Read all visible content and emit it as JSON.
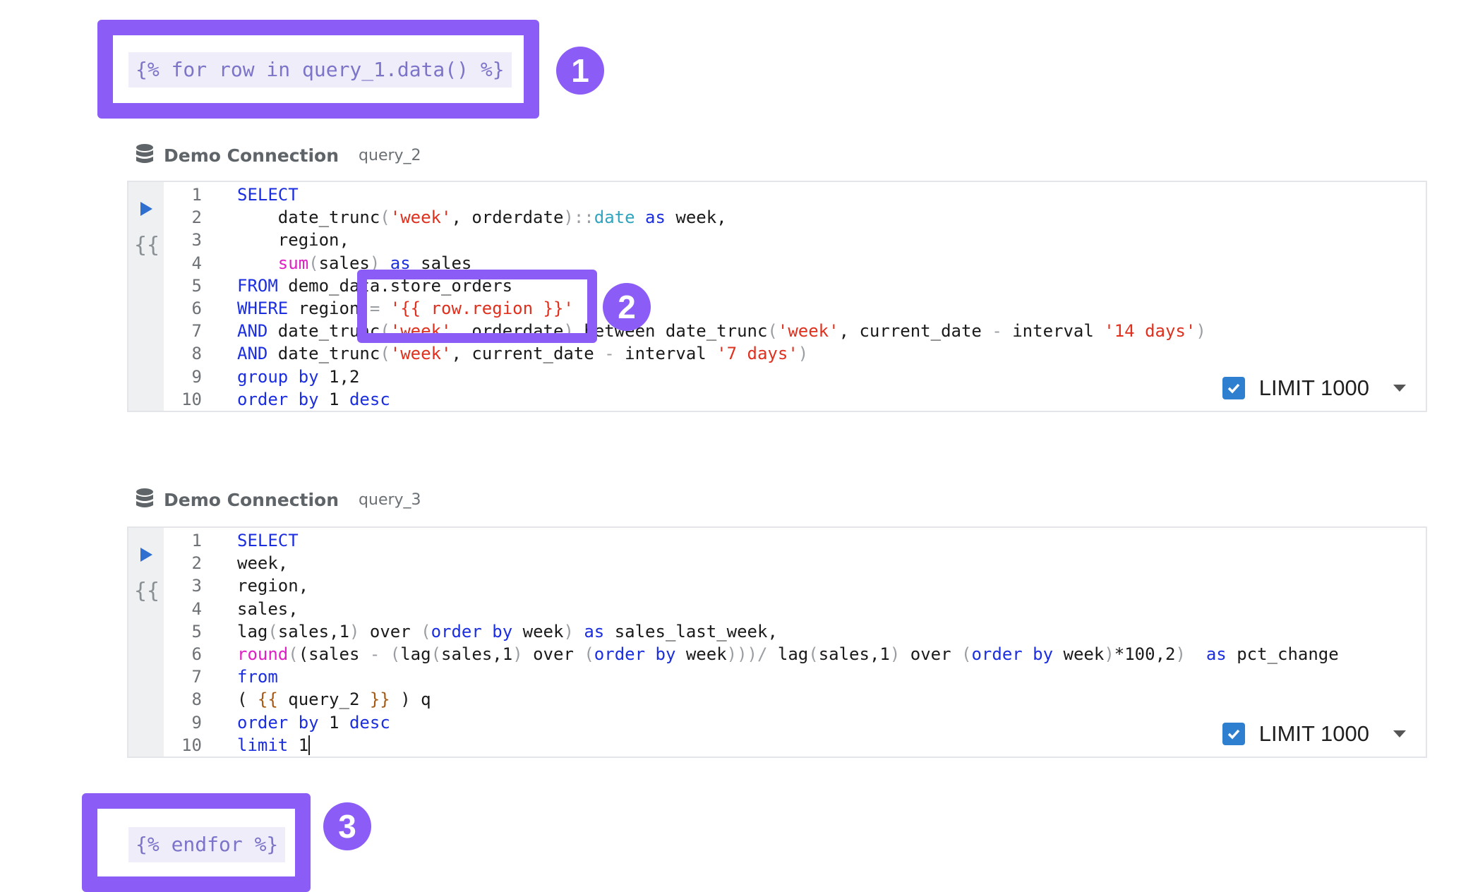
{
  "loop_start": "{% for row in query_1.data() %}",
  "loop_end": "{% endfor %}",
  "callouts": [
    "1",
    "2",
    "3"
  ],
  "cells": [
    {
      "connection": "Demo Connection",
      "query_name": "query_2",
      "limit_label": "LIMIT 1000",
      "limit_checked": true,
      "lines": [
        {
          "n": "1",
          "segs": [
            {
              "t": "SELECT",
              "c": "kw"
            }
          ]
        },
        {
          "n": "2",
          "segs": [
            {
              "t": "    date_trunc",
              "c": ""
            },
            {
              "t": "(",
              "c": "op"
            },
            {
              "t": "'week'",
              "c": "str"
            },
            {
              "t": ", orderdate",
              "c": ""
            },
            {
              "t": ")::",
              "c": "op"
            },
            {
              "t": "date",
              "c": "typ"
            },
            {
              "t": " ",
              "c": ""
            },
            {
              "t": "as",
              "c": "kw"
            },
            {
              "t": " week,",
              "c": ""
            }
          ]
        },
        {
          "n": "3",
          "segs": [
            {
              "t": "    region,",
              "c": ""
            }
          ]
        },
        {
          "n": "4",
          "segs": [
            {
              "t": "    ",
              "c": ""
            },
            {
              "t": "sum",
              "c": "fn"
            },
            {
              "t": "(",
              "c": "op"
            },
            {
              "t": "sales",
              "c": ""
            },
            {
              "t": ")",
              "c": "op"
            },
            {
              "t": " ",
              "c": ""
            },
            {
              "t": "as",
              "c": "kw"
            },
            {
              "t": " sales",
              "c": ""
            }
          ]
        },
        {
          "n": "5",
          "segs": [
            {
              "t": "FROM",
              "c": "kw"
            },
            {
              "t": " demo_data.store_orders",
              "c": ""
            }
          ]
        },
        {
          "n": "6",
          "segs": [
            {
              "t": "WHERE",
              "c": "kw"
            },
            {
              "t": " region ",
              "c": ""
            },
            {
              "t": "=",
              "c": "op"
            },
            {
              "t": " ",
              "c": ""
            },
            {
              "t": "'{{ row.region }}'",
              "c": "str"
            }
          ]
        },
        {
          "n": "7",
          "segs": [
            {
              "t": "AND",
              "c": "kw"
            },
            {
              "t": " date_trunc",
              "c": ""
            },
            {
              "t": "(",
              "c": "op"
            },
            {
              "t": "'week'",
              "c": "str"
            },
            {
              "t": ", orderdate",
              "c": ""
            },
            {
              "t": ")",
              "c": "op"
            },
            {
              "t": " between date_trunc",
              "c": ""
            },
            {
              "t": "(",
              "c": "op"
            },
            {
              "t": "'week'",
              "c": "str"
            },
            {
              "t": ", current_date ",
              "c": ""
            },
            {
              "t": "-",
              "c": "op"
            },
            {
              "t": " interval ",
              "c": ""
            },
            {
              "t": "'14 days'",
              "c": "str"
            },
            {
              "t": ")",
              "c": "op"
            }
          ]
        },
        {
          "n": "8",
          "segs": [
            {
              "t": "AND",
              "c": "kw"
            },
            {
              "t": " date_trunc",
              "c": ""
            },
            {
              "t": "(",
              "c": "op"
            },
            {
              "t": "'week'",
              "c": "str"
            },
            {
              "t": ", current_date ",
              "c": ""
            },
            {
              "t": "-",
              "c": "op"
            },
            {
              "t": " interval ",
              "c": ""
            },
            {
              "t": "'7 days'",
              "c": "str"
            },
            {
              "t": ")",
              "c": "op"
            }
          ]
        },
        {
          "n": "9",
          "segs": [
            {
              "t": "group",
              "c": "kw"
            },
            {
              "t": " ",
              "c": ""
            },
            {
              "t": "by",
              "c": "kw"
            },
            {
              "t": " 1,2",
              "c": ""
            }
          ]
        },
        {
          "n": "10",
          "segs": [
            {
              "t": "order",
              "c": "kw"
            },
            {
              "t": " ",
              "c": ""
            },
            {
              "t": "by",
              "c": "kw"
            },
            {
              "t": " 1 ",
              "c": ""
            },
            {
              "t": "desc",
              "c": "kw"
            }
          ]
        }
      ]
    },
    {
      "connection": "Demo Connection",
      "query_name": "query_3",
      "limit_label": "LIMIT 1000",
      "limit_checked": true,
      "lines": [
        {
          "n": "1",
          "segs": [
            {
              "t": "SELECT",
              "c": "kw"
            }
          ]
        },
        {
          "n": "2",
          "segs": [
            {
              "t": "week,",
              "c": ""
            }
          ]
        },
        {
          "n": "3",
          "segs": [
            {
              "t": "region,",
              "c": ""
            }
          ]
        },
        {
          "n": "4",
          "segs": [
            {
              "t": "sales,",
              "c": ""
            }
          ]
        },
        {
          "n": "5",
          "segs": [
            {
              "t": "lag",
              "c": ""
            },
            {
              "t": "(",
              "c": "op"
            },
            {
              "t": "sales,1",
              "c": ""
            },
            {
              "t": ")",
              "c": "op"
            },
            {
              "t": " over ",
              "c": ""
            },
            {
              "t": "(",
              "c": "op"
            },
            {
              "t": "order",
              "c": "kw"
            },
            {
              "t": " ",
              "c": ""
            },
            {
              "t": "by",
              "c": "kw"
            },
            {
              "t": " week",
              "c": ""
            },
            {
              "t": ")",
              "c": "op"
            },
            {
              "t": " ",
              "c": ""
            },
            {
              "t": "as",
              "c": "kw"
            },
            {
              "t": " sales_last_week,",
              "c": ""
            }
          ]
        },
        {
          "n": "6",
          "segs": [
            {
              "t": "round",
              "c": "fn"
            },
            {
              "t": "(",
              "c": "op"
            },
            {
              "t": "(sales ",
              "c": ""
            },
            {
              "t": "-",
              "c": "op"
            },
            {
              "t": " ",
              "c": ""
            },
            {
              "t": "(",
              "c": "op"
            },
            {
              "t": "lag",
              "c": ""
            },
            {
              "t": "(",
              "c": "op"
            },
            {
              "t": "sales,1",
              "c": ""
            },
            {
              "t": ")",
              "c": "op"
            },
            {
              "t": " over ",
              "c": ""
            },
            {
              "t": "(",
              "c": "op"
            },
            {
              "t": "order",
              "c": "kw"
            },
            {
              "t": " ",
              "c": ""
            },
            {
              "t": "by",
              "c": "kw"
            },
            {
              "t": " week",
              "c": ""
            },
            {
              "t": ")))/",
              "c": "op"
            },
            {
              "t": " lag",
              "c": ""
            },
            {
              "t": "(",
              "c": "op"
            },
            {
              "t": "sales,1",
              "c": ""
            },
            {
              "t": ")",
              "c": "op"
            },
            {
              "t": " over ",
              "c": ""
            },
            {
              "t": "(",
              "c": "op"
            },
            {
              "t": "order",
              "c": "kw"
            },
            {
              "t": " ",
              "c": ""
            },
            {
              "t": "by",
              "c": "kw"
            },
            {
              "t": " week",
              "c": ""
            },
            {
              "t": ")",
              "c": "op"
            },
            {
              "t": "*100,2",
              "c": ""
            },
            {
              "t": ")",
              "c": "op"
            },
            {
              "t": "  ",
              "c": ""
            },
            {
              "t": "as",
              "c": "kw"
            },
            {
              "t": " pct_change",
              "c": ""
            }
          ]
        },
        {
          "n": "7",
          "segs": [
            {
              "t": "from",
              "c": "kw"
            }
          ]
        },
        {
          "n": "8",
          "segs": [
            {
              "t": "( ",
              "c": ""
            },
            {
              "t": "{{",
              "c": "jn"
            },
            {
              "t": " query_2 ",
              "c": ""
            },
            {
              "t": "}}",
              "c": "jn"
            },
            {
              "t": " ) q",
              "c": ""
            }
          ]
        },
        {
          "n": "9",
          "segs": [
            {
              "t": "order",
              "c": "kw"
            },
            {
              "t": " ",
              "c": ""
            },
            {
              "t": "by",
              "c": "kw"
            },
            {
              "t": " 1 ",
              "c": ""
            },
            {
              "t": "desc",
              "c": "kw"
            }
          ]
        },
        {
          "n": "10",
          "segs": [
            {
              "t": "limit",
              "c": "kw"
            },
            {
              "t": " 1",
              "c": ""
            }
          ]
        }
      ]
    }
  ]
}
